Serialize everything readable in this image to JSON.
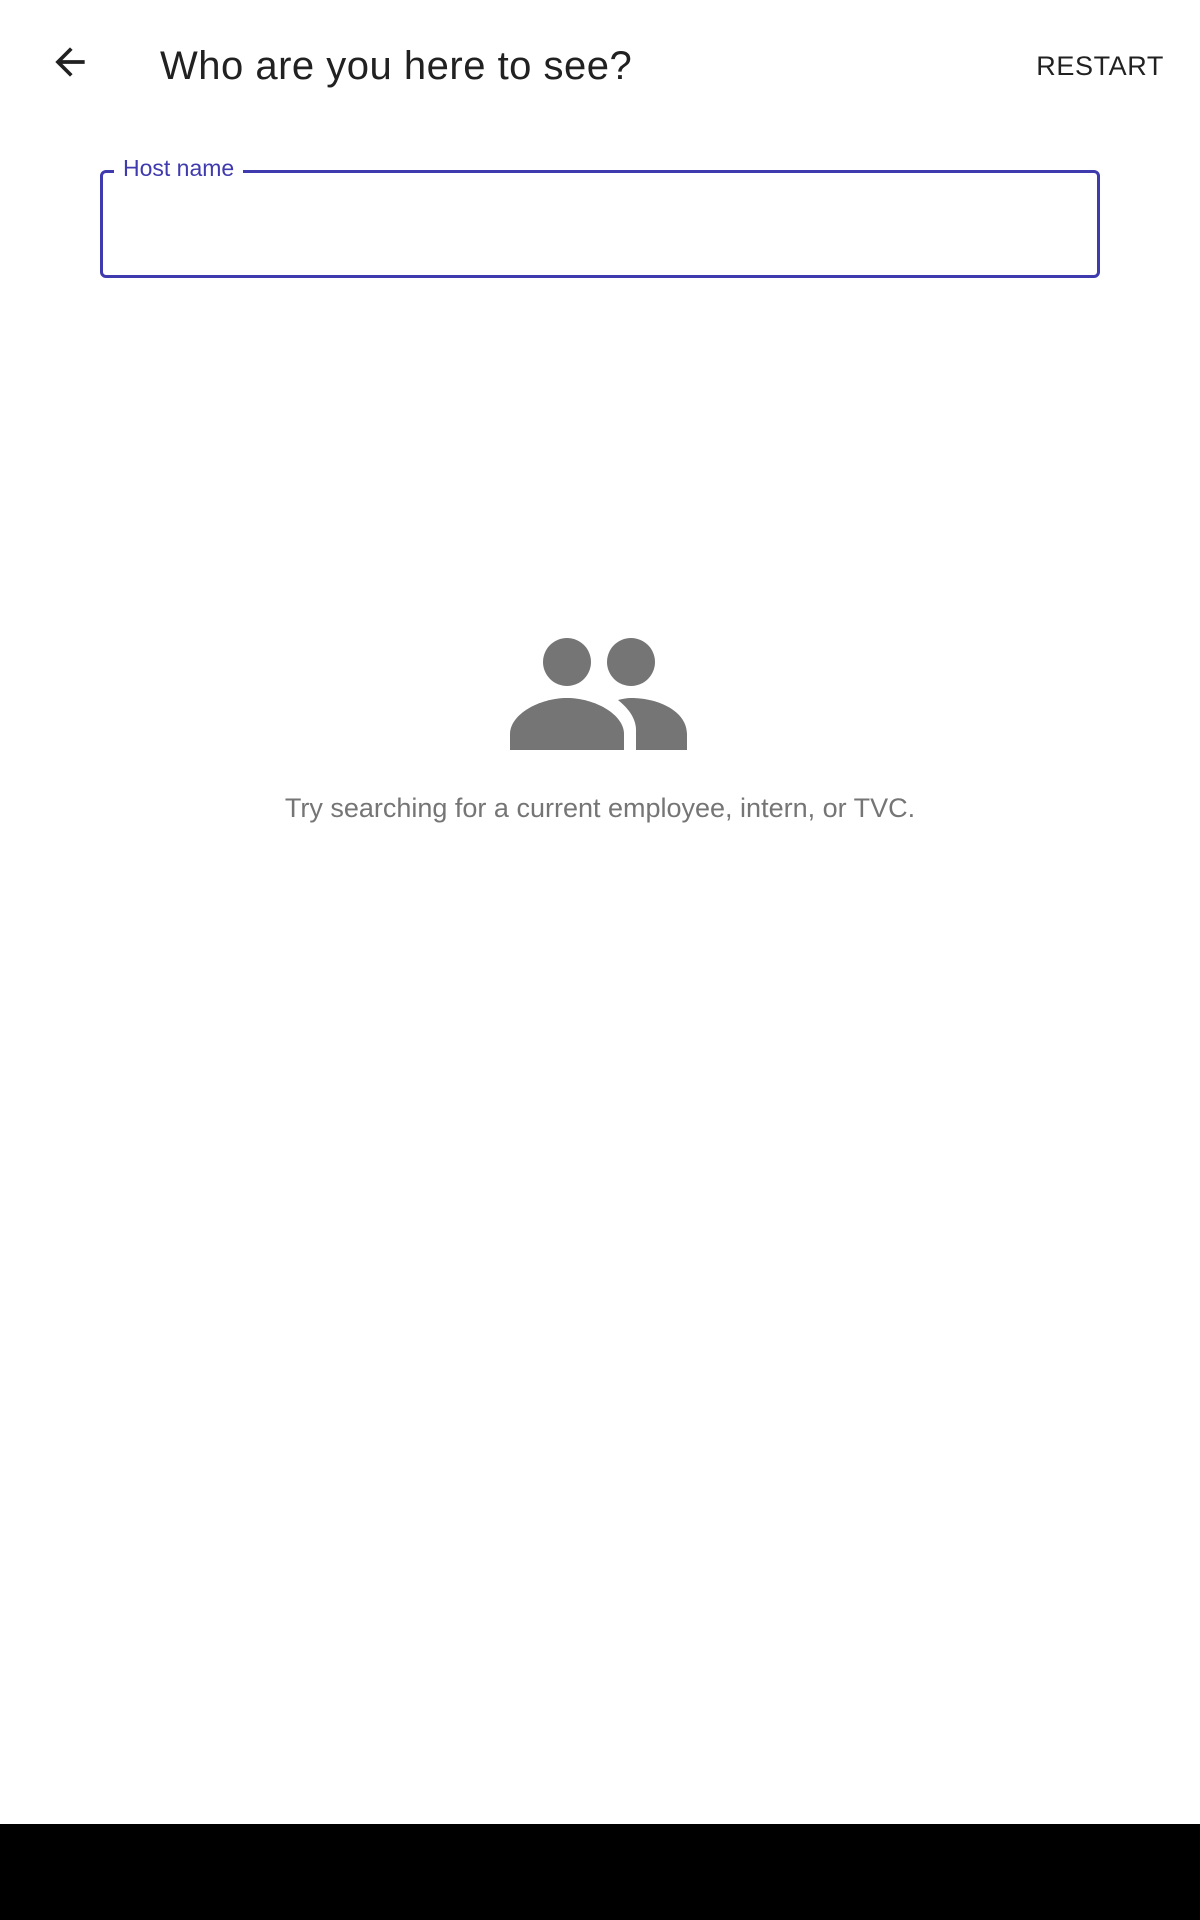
{
  "app_bar": {
    "back_icon": "arrow-back-icon",
    "title": "Who are you here to see?",
    "restart_label": "RESTART"
  },
  "host_field": {
    "label": "Host name",
    "value": "",
    "accent_color": "#3f3aae"
  },
  "empty_state": {
    "icon": "people-icon",
    "message": "Try searching for a current employee, intern, or TVC."
  },
  "colors": {
    "text_primary": "#212121",
    "text_secondary": "#757575",
    "icon_gray": "#757575",
    "nav_bar": "#000000"
  }
}
